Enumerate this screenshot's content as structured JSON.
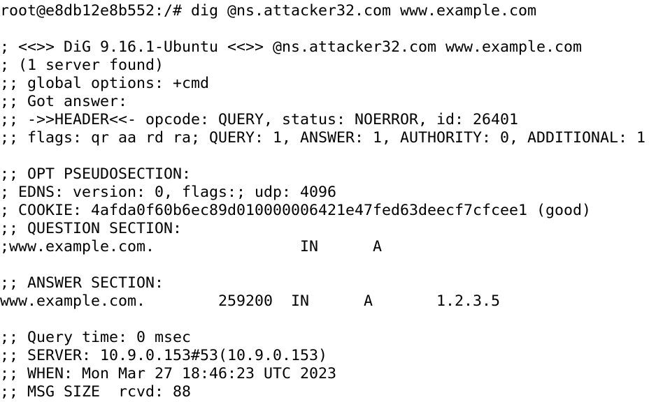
{
  "terminal": {
    "lines": [
      "root@e8db12e8b552:/# dig @ns.attacker32.com www.example.com",
      "",
      "; <<>> DiG 9.16.1-Ubuntu <<>> @ns.attacker32.com www.example.com",
      "; (1 server found)",
      ";; global options: +cmd",
      ";; Got answer:",
      ";; ->>HEADER<<- opcode: QUERY, status: NOERROR, id: 26401",
      ";; flags: qr aa rd ra; QUERY: 1, ANSWER: 1, AUTHORITY: 0, ADDITIONAL: 1",
      "",
      ";; OPT PSEUDOSECTION:",
      "; EDNS: version: 0, flags:; udp: 4096",
      "; COOKIE: 4afda0f60b6ec89d010000006421e47fed63deecf7cfcee1 (good)",
      ";; QUESTION SECTION:",
      ";www.example.com.                IN      A",
      "",
      ";; ANSWER SECTION:",
      "www.example.com.        259200  IN      A       1.2.3.5",
      "",
      ";; Query time: 0 msec",
      ";; SERVER: 10.9.0.153#53(10.9.0.153)",
      ";; WHEN: Mon Mar 27 18:46:23 UTC 2023",
      ";; MSG SIZE  rcvd: 88"
    ]
  }
}
